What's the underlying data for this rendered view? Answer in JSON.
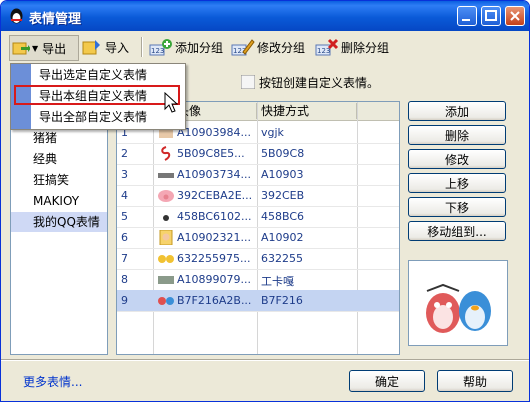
{
  "window": {
    "title": "表情管理"
  },
  "toolbar": {
    "export_label": "导出",
    "import_label": "导入",
    "add_group_label": "添加分组",
    "edit_group_label": "修改分组",
    "delete_group_label": "删除分组"
  },
  "export_menu": {
    "items": [
      "导出选定自定义表情",
      "导出本组自定义表情",
      "导出全部自定义表情"
    ],
    "highlighted_index": 1
  },
  "categories": {
    "items": [
      "猪猪",
      "经典",
      "狂搞笑",
      "MAKIOY",
      "我的QQ表情"
    ],
    "selected_index": 4
  },
  "hint": {
    "text": "按钮创建自定义表情。"
  },
  "table": {
    "headers": [
      "头像",
      "快捷方式"
    ],
    "rows": [
      {
        "num": "1",
        "image": "A10903984...",
        "shortcut": "vgjk"
      },
      {
        "num": "2",
        "image": "5B09C8E5...",
        "shortcut": "5B09C8"
      },
      {
        "num": "3",
        "image": "A10903734...",
        "shortcut": "A10903"
      },
      {
        "num": "4",
        "image": "392CEBA2E...",
        "shortcut": "392CEB"
      },
      {
        "num": "5",
        "image": "458BC6102...",
        "shortcut": "458BC6"
      },
      {
        "num": "6",
        "image": "A10902321...",
        "shortcut": "A10902"
      },
      {
        "num": "7",
        "image": "632255975...",
        "shortcut": "632255"
      },
      {
        "num": "8",
        "image": "A10899079...",
        "shortcut": "工卡嘎"
      },
      {
        "num": "9",
        "image": "B7F216A2B...",
        "shortcut": "B7F216"
      }
    ],
    "selected_row": 9
  },
  "actions": {
    "add": "添加",
    "delete": "删除",
    "edit": "修改",
    "move_up": "上移",
    "move_down": "下移",
    "move_to_group": "移动组到..."
  },
  "footer": {
    "more_link": "更多表情...",
    "ok": "确定",
    "help": "帮助"
  },
  "colors": {
    "titlebar": "#0a5ad8",
    "selection": "#c4d4f2",
    "menu_highlight_border": "#d81a1a",
    "link": "#0033cc"
  }
}
